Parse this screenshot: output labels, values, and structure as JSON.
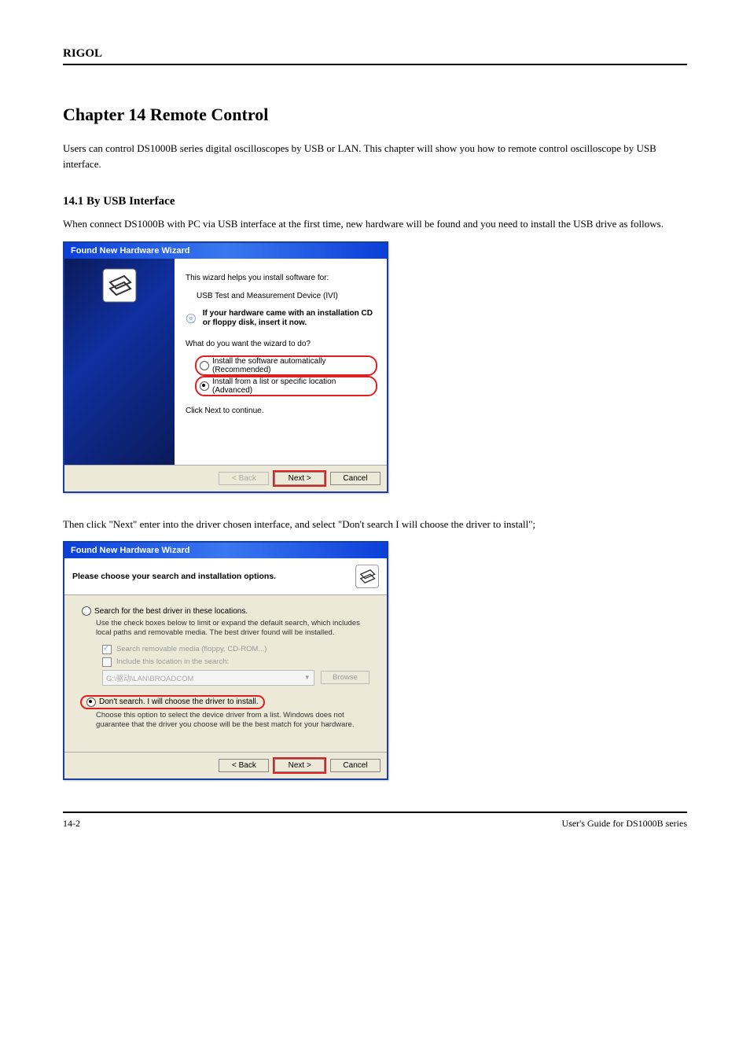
{
  "doc": {
    "header": "RIGOL",
    "title": "Chapter 14 Remote Control",
    "intro": "Users can control DS1000B series digital oscilloscopes by USB or LAN. This chapter will show you how to remote control oscilloscope by USB interface.",
    "section_label": "14.1 By USB Interface",
    "section_p1": "When connect DS1000B with PC via USB interface at the first time, new hardware will be found and you need to install the USB drive as follows.",
    "section_p2": "Then click \"Next\" enter into the driver chosen interface, and select \"Don't search I will choose the driver to install\";",
    "footer_left": "14-2",
    "footer_right": "User's Guide for DS1000B series"
  },
  "wizard1": {
    "title": "Found New Hardware Wizard",
    "line1": "This wizard helps you install software for:",
    "device": "USB Test and Measurement Device (IVI)",
    "cd_text": "If your hardware came with an installation CD or floppy disk, insert it now.",
    "question": "What do you want the wizard to do?",
    "opt_auto": "Install the software automatically (Recommended)",
    "opt_list": "Install from a list or specific location (Advanced)",
    "continue": "Click Next to continue.",
    "back": "< Back",
    "next": "Next >",
    "cancel": "Cancel"
  },
  "wizard2": {
    "title": "Found New Hardware Wizard",
    "heading": "Please choose your search and installation options.",
    "opt_search": "Search for the best driver in these locations.",
    "search_desc": "Use the check boxes below to limit or expand the default search, which includes local paths and removable media. The best driver found will be installed.",
    "chk_media": "Search removable media (floppy, CD-ROM...)",
    "chk_include": "Include this location in the search:",
    "path_value": "G:\\驱动\\LAN\\BROADCOM",
    "browse": "Browse",
    "opt_noSearch": "Don't search. I will choose the driver to install.",
    "noSearch_desc": "Choose this option to select the device driver from a list.  Windows does not guarantee that the driver you choose will be the best match for your hardware.",
    "back": "< Back",
    "next": "Next >",
    "cancel": "Cancel"
  }
}
